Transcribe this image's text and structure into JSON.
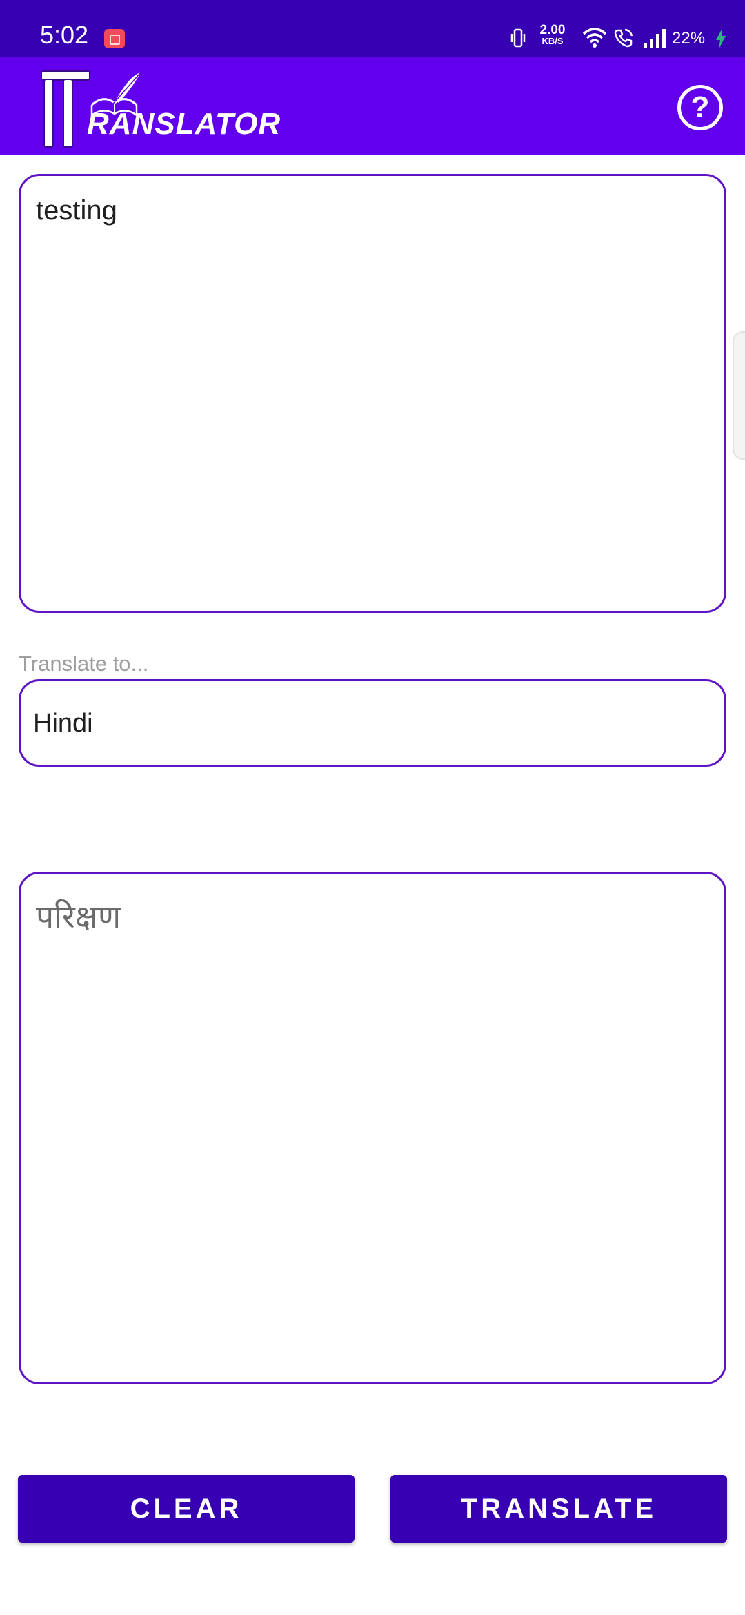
{
  "status_bar": {
    "time": "5:02",
    "net_speed_value": "2.00",
    "net_speed_unit": "KB/S",
    "battery": "22%"
  },
  "app_bar": {
    "title": "RANSLATOR",
    "logo_letter": "T",
    "help_glyph": "?"
  },
  "input": {
    "value": "testing"
  },
  "language": {
    "label": "Translate to...",
    "selected": "Hindi"
  },
  "output": {
    "value": "परिक्षण"
  },
  "buttons": {
    "clear": "CLEAR",
    "translate": "TRANSLATE"
  },
  "colors": {
    "status_bar": "#3700b3",
    "app_bar": "#6200ee",
    "border": "#5e13c4",
    "button": "#3700b3"
  }
}
